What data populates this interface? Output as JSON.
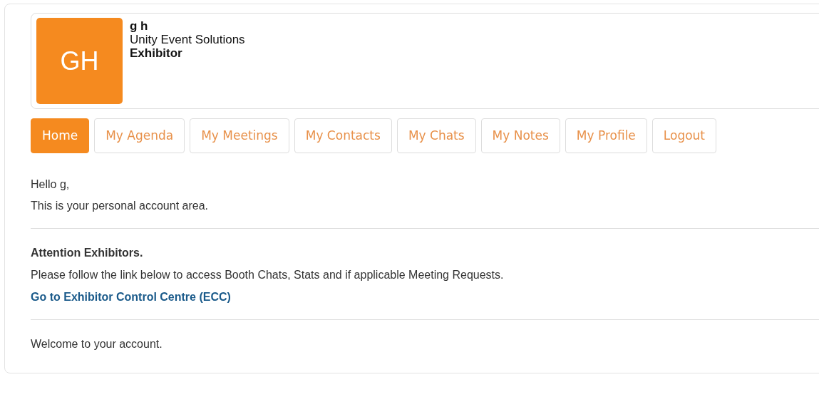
{
  "profile": {
    "avatar_initials": "GH",
    "name": "g h",
    "company": "Unity Event Solutions",
    "role": "Exhibitor"
  },
  "nav": [
    {
      "label": "Home",
      "selected": true
    },
    {
      "label": "My Agenda",
      "selected": false
    },
    {
      "label": "My Meetings",
      "selected": false
    },
    {
      "label": "My Contacts",
      "selected": false
    },
    {
      "label": "My Chats",
      "selected": false
    },
    {
      "label": "My Notes",
      "selected": false
    },
    {
      "label": "My Profile",
      "selected": false
    },
    {
      "label": "Logout",
      "selected": false
    }
  ],
  "greeting": "Hello g,",
  "intro": "This is your personal account area.",
  "attention": {
    "heading": "Attention Exhibitors.",
    "text": "Please follow the link below to access Booth Chats, Stats and if applicable Meeting Requests.",
    "link": "Go to Exhibitor Control Centre (ECC)"
  },
  "footer_text": "Welcome to your account."
}
